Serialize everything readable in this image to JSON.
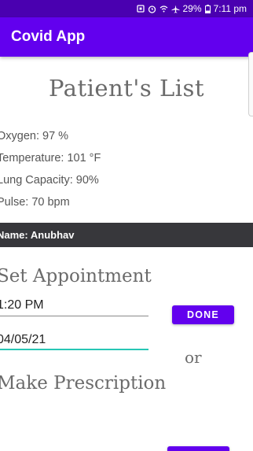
{
  "status_bar": {
    "icons": [
      "nfc-icon",
      "alarm-icon",
      "wifi-icon",
      "airplane-icon",
      "battery-icon"
    ],
    "battery": "29%",
    "time": "7:11 pm"
  },
  "app_bar": {
    "title": "Covid App"
  },
  "page": {
    "title": "Patient's List"
  },
  "vitals": {
    "oxygen": "Oxygen: 97 %",
    "temperature": "Temperature: 101 °F",
    "lung_capacity": "Lung Capacity: 90%",
    "pulse": "Pulse: 70 bpm"
  },
  "patient": {
    "name_label": "Name: Anubhav"
  },
  "appointment": {
    "heading": "Set Appointment",
    "time_value": "1:20 PM",
    "date_value": "04/05/21",
    "done_label": "DONE"
  },
  "separator": {
    "or_label": "or"
  },
  "prescription": {
    "heading": "Make Prescription"
  },
  "colors": {
    "primary": "#6200ee",
    "status_bar": "#4a00b0",
    "name_bar": "#37373b",
    "accent_underline": "#27c6b5"
  }
}
